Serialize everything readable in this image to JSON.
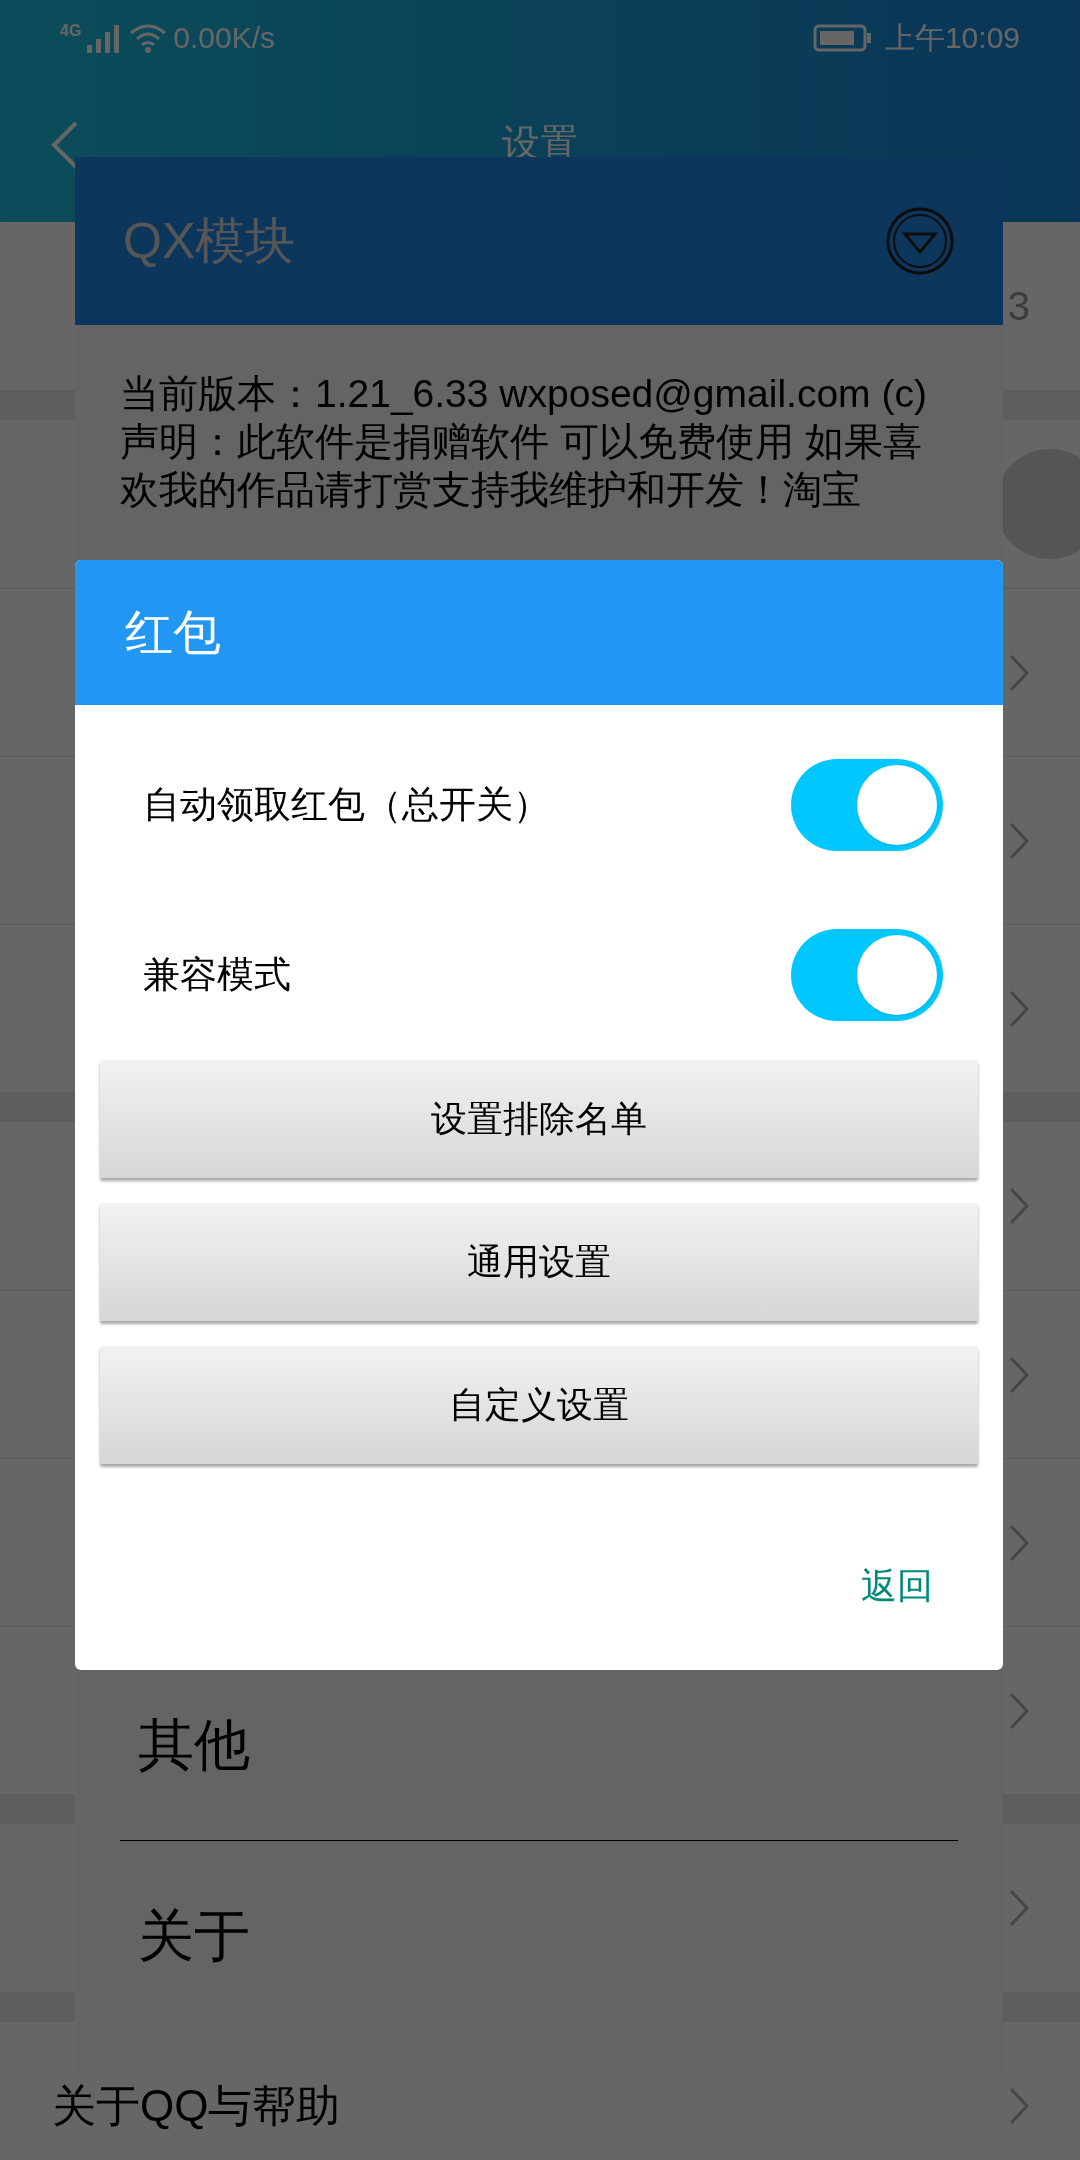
{
  "status_bar": {
    "network": "4G",
    "speed": "0.00K/s",
    "time": "上午10:09"
  },
  "app_bar": {
    "title": "设置"
  },
  "sections": [
    [
      {
        "kind": "value",
        "value": "3"
      }
    ],
    [
      {
        "kind": "avatar"
      },
      {
        "kind": "link"
      },
      {
        "kind": "link"
      },
      {
        "kind": "link"
      }
    ],
    [
      {
        "kind": "link"
      },
      {
        "kind": "link"
      },
      {
        "kind": "link"
      },
      {
        "kind": "link"
      }
    ],
    [
      {
        "kind": "link"
      }
    ],
    [
      {
        "kind": "link",
        "label": "关于QQ与帮助"
      }
    ]
  ],
  "module_dialog": {
    "title": "QX模块",
    "paragraphs": [
      "当前版本：1.21_6.33 wxposed@gmail.com (c)",
      "声明：此软件是捐赠软件 可以免费使用 如果喜欢我的作品请打赏支持我维护和开发！淘宝"
    ],
    "menu_items": [
      "其他",
      "关于"
    ]
  },
  "red_packet_dialog": {
    "title": "红包",
    "toggles": [
      {
        "label": "自动领取红包（总开关）",
        "on": true
      },
      {
        "label": "兼容模式",
        "on": true
      }
    ],
    "buttons": [
      "设置排除名单",
      "通用设置",
      "自定义设置"
    ],
    "action": "返回"
  }
}
